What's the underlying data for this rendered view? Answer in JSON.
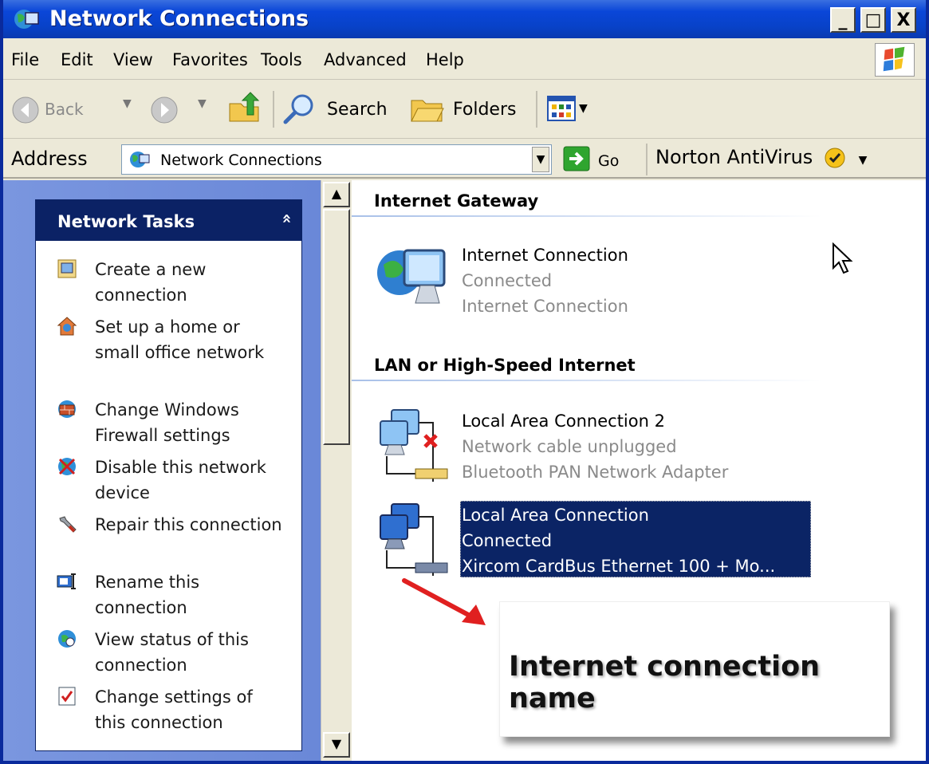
{
  "window": {
    "title": "Network Connections"
  },
  "menu": [
    "File",
    "Edit",
    "View",
    "Favorites",
    "Tools",
    "Advanced",
    "Help"
  ],
  "toolbar": {
    "back_label": "Back",
    "search_label": "Search",
    "folders_label": "Folders"
  },
  "address": {
    "label": "Address",
    "value": "Network Connections",
    "go_label": "Go",
    "norton_label": "Norton AntiVirus"
  },
  "tasks": {
    "title": "Network Tasks",
    "collapse_glyph": "»",
    "items": [
      {
        "label": "Create a new connection",
        "icon": "new-connection-icon"
      },
      {
        "label": "Set up a home or small office network",
        "icon": "home-network-icon"
      },
      {
        "label": "Change Windows Firewall settings",
        "icon": "firewall-icon"
      },
      {
        "label": "Disable this network device",
        "icon": "disable-device-icon"
      },
      {
        "label": "Repair this connection",
        "icon": "repair-icon"
      },
      {
        "label": "Rename this connection",
        "icon": "rename-icon"
      },
      {
        "label": "View status of this connection",
        "icon": "status-icon"
      },
      {
        "label": "Change settings of this connection",
        "icon": "settings-icon"
      }
    ]
  },
  "groups": [
    {
      "title": "Internet Gateway",
      "connections": [
        {
          "name": "Internet Connection",
          "status": "Connected",
          "device": "Internet Connection",
          "icon": "internet-gateway-icon"
        }
      ]
    },
    {
      "title": "LAN or High-Speed Internet",
      "connections": [
        {
          "name": "Local Area Connection 2",
          "status": "Network cable unplugged",
          "device": "Bluetooth PAN Network Adapter",
          "icon": "lan-unplugged-icon"
        },
        {
          "name": "Local Area Connection",
          "status": "Connected",
          "device": "Xircom CardBus Ethernet 100 + Mo...",
          "icon": "lan-connected-icon",
          "selected": true
        }
      ]
    }
  ],
  "annotation": {
    "text": "Internet connection name"
  },
  "colors": {
    "title_bar": "#0a46d8",
    "selection": "#0b2465",
    "task_header": "#0b2265",
    "pane_bg": "#7a96df"
  }
}
